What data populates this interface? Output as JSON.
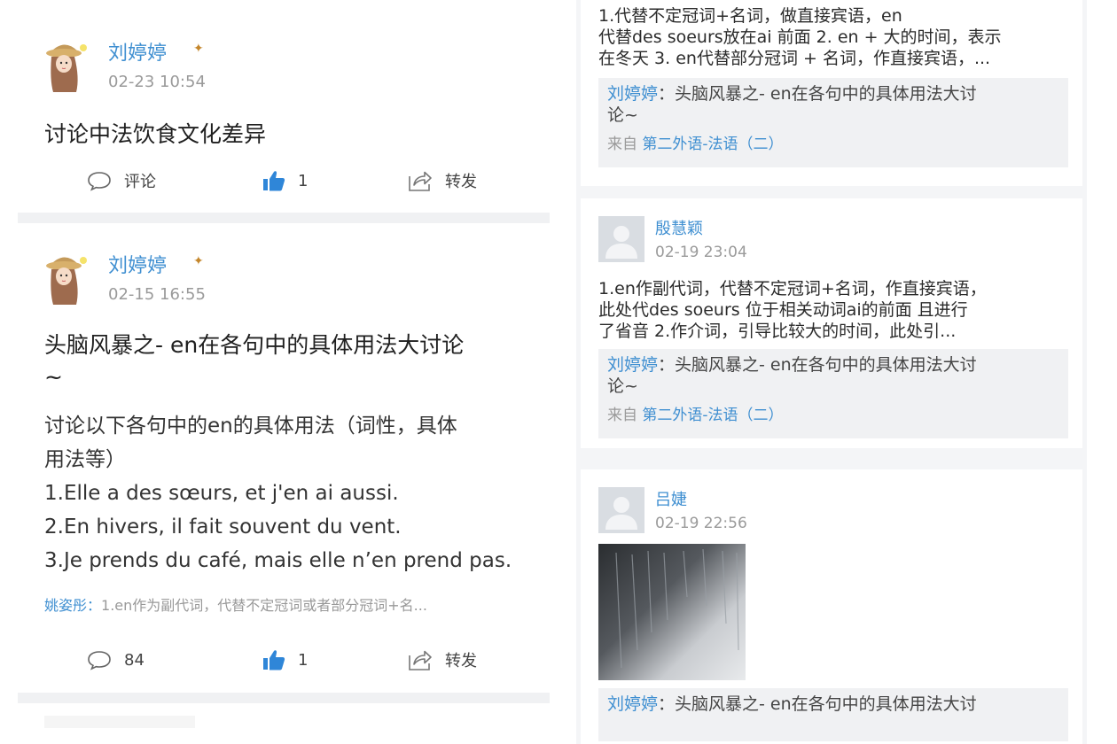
{
  "left": {
    "posts": [
      {
        "author": "刘婷婷",
        "time": "02-23 10:54",
        "title": "讨论中法饮食文化差异",
        "actions": {
          "comment": "评论",
          "like": "1",
          "share": "转发"
        }
      },
      {
        "author": "刘婷婷",
        "time": "02-15 16:55",
        "title_line1": "头脑风暴之- en在各句中的具体用法大讨论",
        "title_line2": "~",
        "body": [
          "讨论以下各句中的en的具体用法（词性，具体",
          "用法等）",
          "1.Elle a des sœurs, et j'en ai aussi.",
          "2.En hivers, il fait souvent du vent.",
          "3.Je prends du café, mais elle n’en prend pas."
        ],
        "comment_preview": {
          "commenter": "姚姿彤：",
          "text": "1.en作为副代词，代替不定冠词或者部分冠词+名..."
        },
        "actions": {
          "comment": "84",
          "like": "1",
          "share": "转发"
        }
      }
    ]
  },
  "right": {
    "cards": [
      {
        "text_lines": [
          "1.代替不定冠词+名词，做直接宾语，en",
          "代替des soeurs放在ai 前面 2. en + 大的时间，表示",
          "在冬天 3. en代替部分冠词 + 名词，作直接宾语，..."
        ],
        "quote": {
          "author": "刘婷婷",
          "sep": "：",
          "text_line1": "头脑风暴之- en在各句中的具体用法大讨",
          "text_line2": "论~",
          "src_prefix": "来自 ",
          "src_name": "第二外语-法语（二）"
        }
      },
      {
        "name": "殷慧颖",
        "time": "02-19 23:04",
        "text_lines": [
          "1.en作副代词，代替不定冠词+名词，作直接宾语，",
          "此处代des soeurs 位于相关动词ai的前面 且进行",
          "了省音 2.作介词，引导比较大的时间，此处引..."
        ],
        "quote": {
          "author": "刘婷婷",
          "sep": "：",
          "text_line1": "头脑风暴之- en在各句中的具体用法大讨",
          "text_line2": "论~",
          "src_prefix": "来自 ",
          "src_name": "第二外语-法语（二）"
        }
      },
      {
        "name": "吕婕",
        "time": "02-19 22:56",
        "quote": {
          "author": "刘婷婷",
          "sep": "：",
          "text_line1": "头脑风暴之- en在各句中的具体用法大讨"
        }
      }
    ]
  },
  "colors": {
    "accent": "#3f8fd1",
    "muted": "#9a9a9a",
    "divider": "#f0f1f3"
  }
}
